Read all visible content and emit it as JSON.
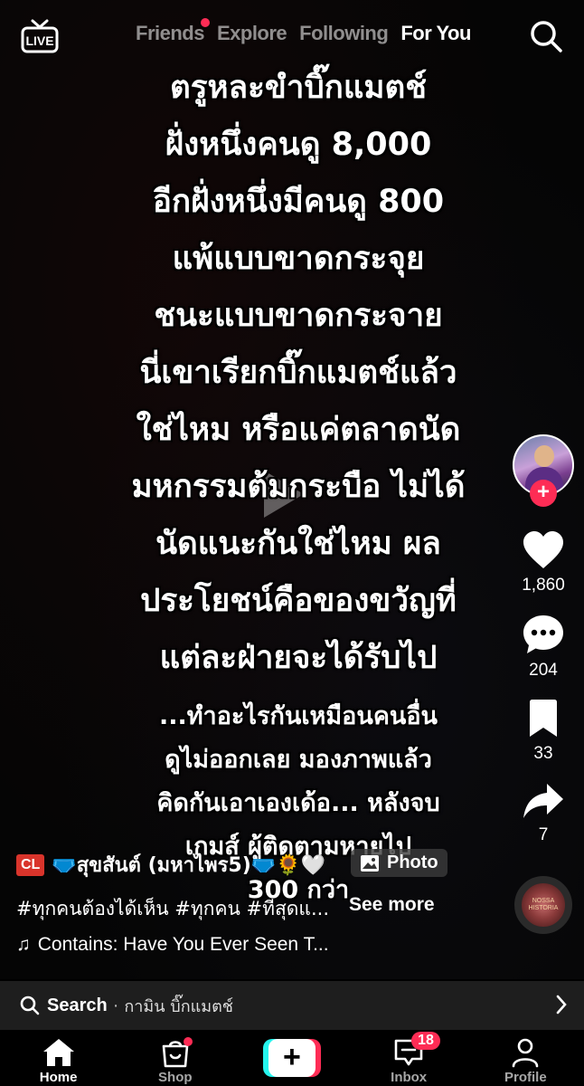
{
  "top": {
    "tabs": [
      {
        "label": "Friends"
      },
      {
        "label": "Explore"
      },
      {
        "label": "Following"
      },
      {
        "label": "For You"
      }
    ]
  },
  "caption": {
    "main_lines": [
      "ตรูหละขำบิ๊กแมตช์",
      "ฝั่งหนึ่งคนดู 8,000",
      "อีกฝั่งหนึ่งมีคนดู 800",
      "แพ้แบบขาดกระจุย",
      "ชนะแบบขาดกระจาย",
      "นี่เขาเรียกบิ๊กแมตช์แล้ว",
      "ใช่ไหม หรือแค่ตลาดนัด",
      "มหกรรมต้มกระบือ ไม่ได้",
      "นัดแนะกันใช่ไหม ผล",
      "ประโยชน์คือของขวัญที่",
      "แต่ละฝ่ายจะได้รับไป"
    ],
    "sub_lines": [
      "...ทำอะไรกันเหมือนคนอื่น",
      "ดูไม่ออกเลย มองภาพแล้ว",
      "คิดกันเอาเองเด้อ... หลังจบ",
      "เกมส์ ผู้ติดตามหายไป",
      "300 กว่า"
    ]
  },
  "rail": {
    "likes": "1,860",
    "comments": "204",
    "saves": "33",
    "shares": "7",
    "disc_text": "NOSSA HISTORIA"
  },
  "post": {
    "badge": "CL",
    "author": "🩲สุขสันต์ (มหาไพร5)🩲🌻🤍",
    "photo_label": "Photo",
    "hashtags": "#ทุกคนต้องได้เห็น #ทุกคน #ที่สุดแ...",
    "see_more": "See more",
    "music": "Contains: Have You Ever Seen T..."
  },
  "search": {
    "label": "Search",
    "separator": "·",
    "query": "กามิน บิ๊กแมตช์"
  },
  "nav": {
    "home": "Home",
    "shop": "Shop",
    "create": "+",
    "inbox": "Inbox",
    "inbox_badge": "18",
    "profile": "Profile"
  },
  "colors": {
    "accent_red": "#fe2c55",
    "accent_cyan": "#25f4ee"
  }
}
